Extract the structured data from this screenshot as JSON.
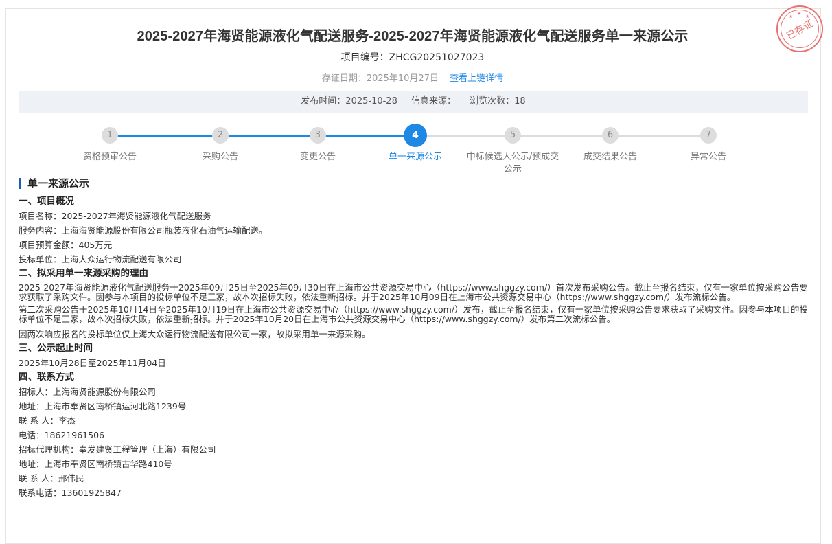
{
  "header": {
    "title": "2025-2027年海贤能源液化气配送服务-2025-2027年海贤能源液化气配送服务单一来源公示",
    "project_no": "项目编号：ZHCG20251027023",
    "cert_date": "存证日期：2025年10月27日",
    "cert_link": "查看上链详情"
  },
  "stamp": {
    "text": "已存证"
  },
  "meta": {
    "publish_time": "发布时间：2025-10-28",
    "source": "信息来源：",
    "views": "浏览次数：18"
  },
  "steps": [
    {
      "num": "1",
      "label": "资格预审公告"
    },
    {
      "num": "2",
      "label": "采购公告"
    },
    {
      "num": "3",
      "label": "变更公告"
    },
    {
      "num": "4",
      "label": "单一来源公示"
    },
    {
      "num": "5",
      "label": "中标候选人公示/预成交公示"
    },
    {
      "num": "6",
      "label": "成交结果公告"
    },
    {
      "num": "7",
      "label": "异常公告"
    }
  ],
  "active_step": 4,
  "progress": {
    "step": 0.5
  },
  "content": {
    "section_title": "单一来源公示",
    "s1": {
      "heading": "一、项目概况",
      "name": "项目名称：2025-2027年海贤能源液化气配送服务",
      "service": "服务内容：上海海贤能源股份有限公司瓶装液化石油气运输配送。",
      "budget": "项目预算金额：405万元",
      "bidder": "投标单位：上海大众运行物流配送有限公司"
    },
    "s2": {
      "heading": "二、拟采用单一来源采购的理由",
      "p1": "2025-2027年海贤能源液化气配送服务于2025年09月25日至2025年09月30日在上海市公共资源交易中心（https://www.shggzy.com/）首次发布采购公告。截止至报名结束，仅有一家单位按采购公告要求获取了采购文件。因参与本项目的投标单位不足三家，故本次招标失败，依法重新招标。并于2025年10月09日在上海市公共资源交易中心（https://www.shggzy.com/）发布流标公告。",
      "p2": "第二次采购公告于2025年10月14日至2025年10月19日在上海市公共资源交易中心（https://www.shggzy.com/）发布，截止至报名结束，仅有一家单位按采购公告要求获取了采购文件。因参与本项目的投标单位不足三家，故本次招标失败，依法重新招标。并于2025年10月20日在上海市公共资源交易中心（https://www.shggzy.com/）发布第二次流标公告。",
      "p3": "因两次响应报名的投标单位仅上海大众运行物流配送有限公司一家，故拟采用单一来源采购。"
    },
    "s3": {
      "heading": "三、公示起止时间",
      "period": "2025年10月28日至2025年11月04日"
    },
    "s4": {
      "heading": "四、联系方式",
      "tenderer": "招标人：上海海贤能源股份有限公司",
      "address1": "地址：上海市奉贤区南桥镇运河北路1239号",
      "contact1": "联 系 人：李杰",
      "phone1": "电话：18621961506",
      "agency": "招标代理机构：奉发建贤工程管理（上海）有限公司",
      "address2": "地址：上海市奉贤区南桥镇古华路410号",
      "contact2": "联 系 人：邢伟民",
      "phone2": "联系电话：13601925847"
    }
  }
}
